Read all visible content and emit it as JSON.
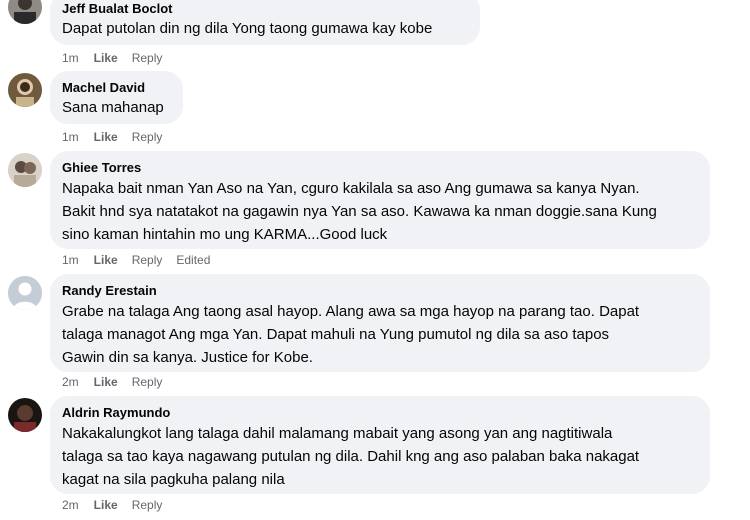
{
  "comments": [
    {
      "author": "Jeff Bualat Boclot",
      "text": "Dapat putolan din ng dila Yong taong gumawa kay kobe",
      "time": "1m",
      "like": "Like",
      "reply": "Reply",
      "edited": ""
    },
    {
      "author": "Machel David",
      "text": "Sana mahanap",
      "time": "1m",
      "like": "Like",
      "reply": "Reply",
      "edited": ""
    },
    {
      "author": "Ghiee Torres",
      "lines": [
        "Napaka bait nman Yan Aso na Yan, cguro kakilala sa aso Ang gumawa sa kanya Nyan.",
        "Bakit hnd sya natatakot na gagawin nya Yan sa aso. Kawawa ka nman doggie.sana Kung",
        "sino kaman hintahin mo ung KARMA...Good luck"
      ],
      "time": "1m",
      "like": "Like",
      "reply": "Reply",
      "edited": "Edited"
    },
    {
      "author": "Randy Erestain",
      "lines": [
        "Grabe na talaga Ang taong asal hayop. Alang awa sa mga hayop na parang tao. Dapat",
        "talaga managot Ang mga Yan. Dapat mahuli na Yung pumutol ng dila sa aso tapos",
        "Gawin din sa kanya. Justice for Kobe."
      ],
      "time": "2m",
      "like": "Like",
      "reply": "Reply",
      "edited": ""
    },
    {
      "author": "Aldrin Raymundo",
      "lines": [
        "Nakakalungkot lang talaga dahil malamang mabait yang asong yan ang nagtitiwala",
        "talaga sa tao kaya nagawang putulan ng dila. Dahil kng ang aso palaban baka nakagat",
        "kagat na sila pagkuha palang nila"
      ],
      "time": "2m",
      "like": "Like",
      "reply": "Reply",
      "edited": ""
    }
  ]
}
